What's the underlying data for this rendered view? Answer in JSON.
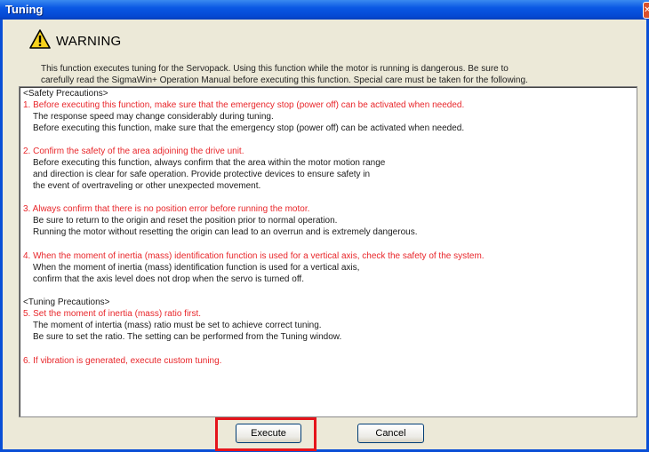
{
  "window": {
    "title": "Tuning"
  },
  "warning": {
    "heading": "WARNING",
    "intro_line1": "This function executes tuning for the Servopack. Using this function while the motor is running is dangerous. Be sure to",
    "intro_line2": "carefully read the SigmaWin+ Operation Manual before executing this function. Special care must be taken for the following."
  },
  "precautions": {
    "safety_heading": "<Safety Precautions>",
    "item1_title": "1. Before executing this function, make sure that the emergency stop (power off) can be activated when needed.",
    "item1_line1": "The response speed may change considerably during tuning.",
    "item1_line2": "Before executing this function, make sure that the emergency stop (power off) can be activated when needed.",
    "item2_title": "2. Confirm the safety of the area adjoining the drive unit.",
    "item2_line1": "Before executing this function, always confirm that the area within the motor motion range",
    "item2_line2": "and direction is clear for safe operation. Provide protective devices to ensure safety in",
    "item2_line3": "the event of overtraveling or other unexpected movement.",
    "item3_title": "3. Always confirm that there is no position error before running the motor.",
    "item3_line1": "Be sure to return to the origin and reset the position prior to normal operation.",
    "item3_line2": "Running the motor without resetting the origin can lead to an overrun and is extremely dangerous.",
    "item4_title": "4. When the moment of inertia (mass) identification function is used for a vertical axis, check the safety of the system.",
    "item4_line1": "When the moment of inertia (mass) identification function is used for a vertical axis,",
    "item4_line2": "confirm that the axis level does not drop when the servo is turned off.",
    "tuning_heading": "<Tuning Precautions>",
    "item5_title": "5. Set the moment of inertia (mass) ratio first.",
    "item5_line1": "The moment of intertia (mass) ratio must be set to achieve correct tuning.",
    "item5_line2": "Be sure to set the ratio. The setting can be performed from the Tuning window.",
    "item6_title": "6. If vibration is generated, execute custom tuning."
  },
  "buttons": {
    "execute": "Execute",
    "cancel": "Cancel"
  },
  "icons": {
    "warning": "warning-triangle-icon",
    "close": "close-icon"
  },
  "colors": {
    "title_bar": "#0a58e4",
    "warning_text": "#e8262a",
    "highlight": "#e5141b",
    "dialog_bg": "#ece9d8"
  }
}
